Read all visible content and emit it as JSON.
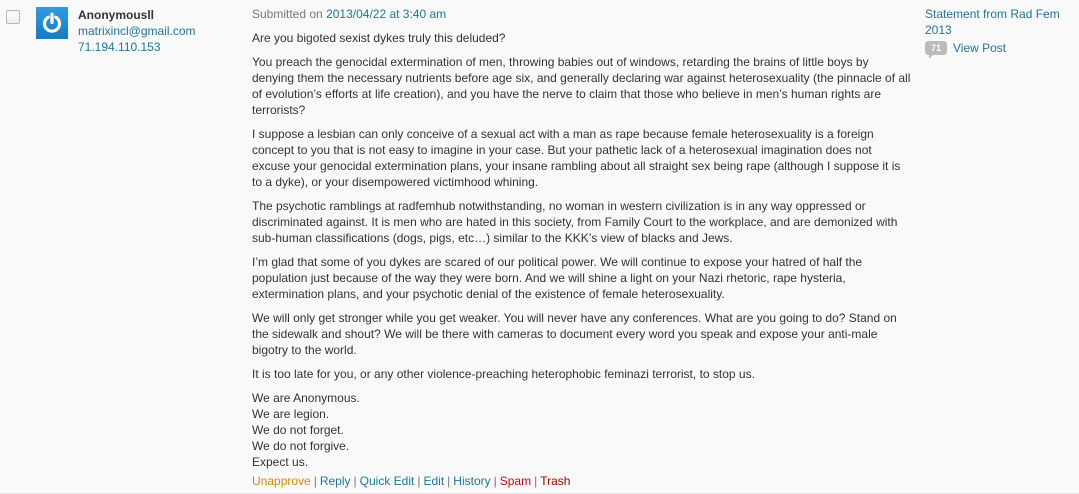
{
  "author": {
    "avatar_icon": "power-icon",
    "name": "Anonymousll",
    "email": "matrixincl@gmail.com",
    "ip": "71.194.110.153"
  },
  "comment": {
    "submitted_prefix": "Submitted on",
    "submitted_date": "2013/04/22 at 3:40 am",
    "paragraphs": [
      "Are you bigoted sexist dykes truly this deluded?",
      "You preach the genocidal extermination of men, throwing babies out of windows, retarding the brains of little boys by denying them the necessary nutrients before age six, and generally declaring war against heterosexuality (the pinnacle of all of evolution’s efforts at life creation), and you have the nerve to claim that those who believe in men’s human rights are terrorists?",
      "I suppose a lesbian can only conceive of a sexual act with a man as rape because female heterosexuality is a foreign concept to you that is not easy to imagine in your case. But your pathetic lack of a heterosexual imagination does not excuse your genocidal extermination plans, your insane rambling about all straight sex being rape (although I suppose it is to a dyke), or your disempowered victimhood whining.",
      "The psychotic ramblings at radfemhub notwithstanding, no woman in western civilization is in any way oppressed or discriminated against. It is men who are hated in this society, from Family Court to the workplace, and are demonized with sub-human classifications (dogs, pigs, etc…) similar to the KKK’s view of blacks and Jews.",
      "I’m glad that some of you dykes are scared of our political power. We will continue to expose your hatred of half the population just because of the way they were born. And we will shine a light on your Nazi rhetoric, rape hysteria, extermination plans, and your psychotic denial of the existence of female heterosexuality.",
      "We will only get stronger while you get weaker. You will never have any conferences. What are you going to do? Stand on the sidewalk and shout? We will be there with cameras to document every word you speak and expose your anti-male bigotry to the world.",
      "It is too late for you, or any other violence-preaching heterophobic feminazi terrorist, to stop us."
    ],
    "closing_lines": [
      "We are Anonymous.",
      "We are legion.",
      "We do not forget.",
      "We do not forgive.",
      "Expect us."
    ]
  },
  "actions": {
    "unapprove": "Unapprove",
    "reply": "Reply",
    "quick_edit": "Quick Edit",
    "edit": "Edit",
    "history": "History",
    "spam": "Spam",
    "trash": "Trash",
    "separator": "|"
  },
  "response": {
    "post_title": "Statement from Rad Fem 2013",
    "comment_count": "71",
    "view_post": "View Post"
  },
  "colors": {
    "link": "#21759b",
    "unapprove": "#d98500",
    "spam": "#bc0b0b",
    "trash": "#a00",
    "avatar_bg": "#1f8dd6",
    "count_bubble": "#bbbbbb"
  }
}
